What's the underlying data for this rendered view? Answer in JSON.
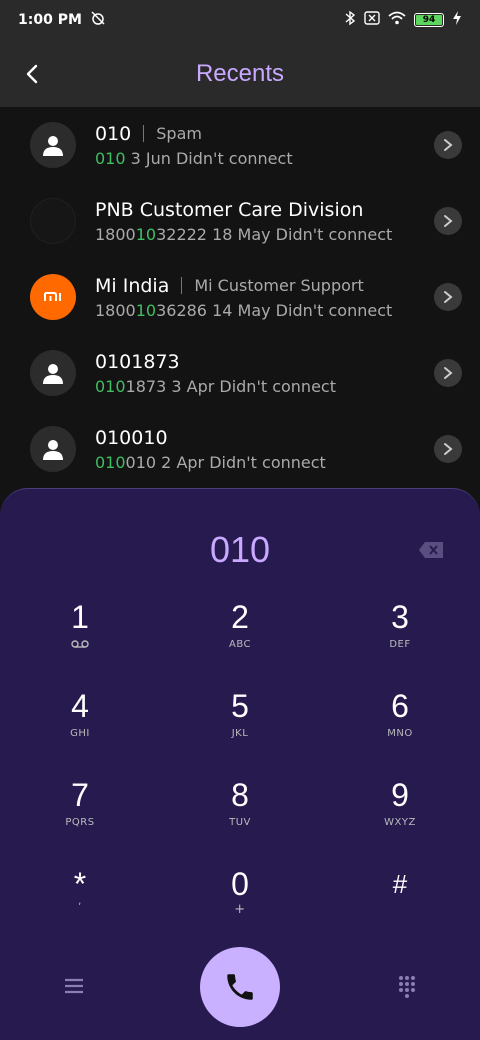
{
  "status": {
    "time": "1:00 PM",
    "battery": "94"
  },
  "header": {
    "title": "Recents"
  },
  "recents": [
    {
      "name": "010",
      "label": "Spam",
      "num_pre": "",
      "num_hl": "010",
      "num_post": "",
      "detail": " 3 Jun Didn't connect",
      "avatar": "person"
    },
    {
      "name": "PNB Customer Care Division",
      "label": "",
      "num_pre": "1800",
      "num_hl": "10",
      "num_post": "32222",
      "detail": " 18 May Didn't connect",
      "avatar": "empty"
    },
    {
      "name": "Mi India",
      "label": "Mi Customer Support",
      "num_pre": "1800",
      "num_hl": "10",
      "num_post": "36286",
      "detail": " 14 May Didn't connect",
      "avatar": "mi"
    },
    {
      "name": "0101873",
      "label": "",
      "num_pre": "",
      "num_hl": "010",
      "num_post": "1873",
      "detail": " 3 Apr Didn't connect",
      "avatar": "person"
    },
    {
      "name": "010010",
      "label": "",
      "num_pre": "",
      "num_hl": "010",
      "num_post": "010",
      "detail": " 2 Apr Didn't connect",
      "avatar": "person"
    }
  ],
  "mi_logo_text": "mi",
  "dialer": {
    "number": "010",
    "keys": [
      {
        "digit": "1",
        "letters": ""
      },
      {
        "digit": "2",
        "letters": "ABC"
      },
      {
        "digit": "3",
        "letters": "DEF"
      },
      {
        "digit": "4",
        "letters": "GHI"
      },
      {
        "digit": "5",
        "letters": "JKL"
      },
      {
        "digit": "6",
        "letters": "MNO"
      },
      {
        "digit": "7",
        "letters": "PQRS"
      },
      {
        "digit": "8",
        "letters": "TUV"
      },
      {
        "digit": "9",
        "letters": "WXYZ"
      },
      {
        "digit": "*",
        "letters": ","
      },
      {
        "digit": "0",
        "letters": "+"
      },
      {
        "digit": "#",
        "letters": ""
      }
    ]
  },
  "colors": {
    "accent": "#c9a8ff",
    "highlight": "#3fbf62",
    "dialer_bg": "#261a4f",
    "call_button": "#c9b1ff"
  }
}
